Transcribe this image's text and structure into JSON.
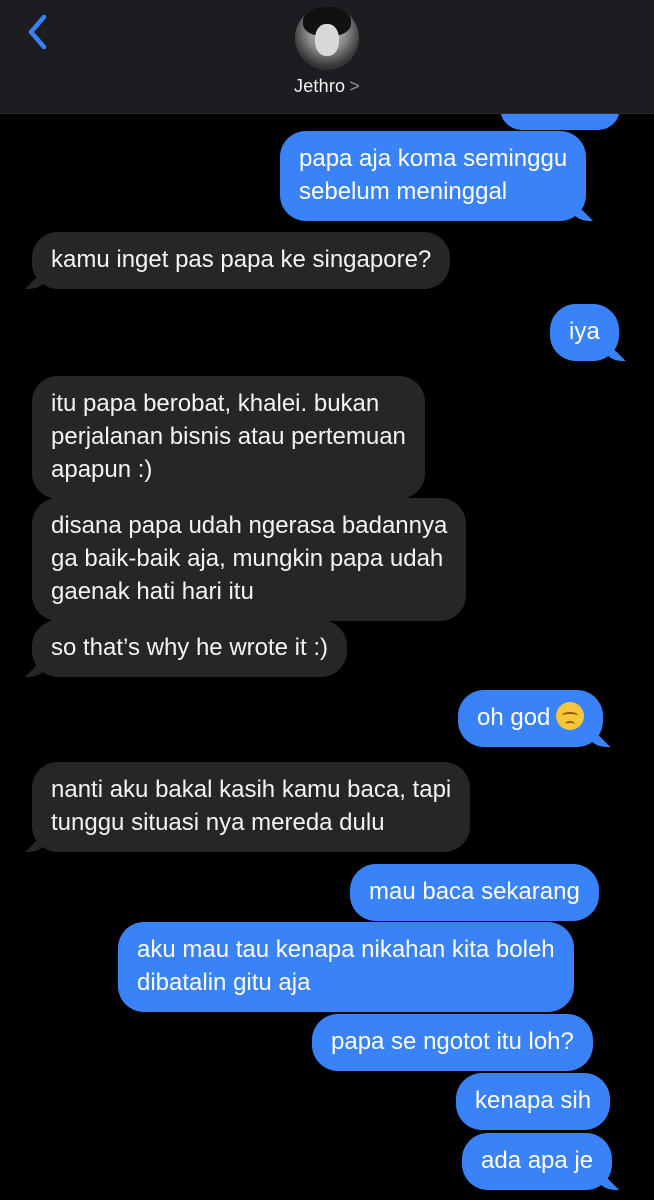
{
  "header": {
    "contact_name": "Jethro",
    "chevron": ">",
    "back_icon": "chevron-left-icon",
    "accent_color": "#3a82f7"
  },
  "messages": [
    {
      "from": "me",
      "text_lines": [
        "papa aja koma seminggu",
        "sebelum meninggal"
      ]
    },
    {
      "from": "them",
      "text_lines": [
        "kamu inget pas papa ke singapore?"
      ]
    },
    {
      "from": "me",
      "text_lines": [
        "iya"
      ]
    },
    {
      "from": "them",
      "text_lines": [
        "itu papa berobat, khalei. bukan",
        "perjalanan bisnis atau pertemuan",
        "apapun :)"
      ]
    },
    {
      "from": "them",
      "text_lines": [
        "disana papa udah ngerasa badannya",
        "ga baik-baik aja, mungkin papa udah",
        "gaenak hati hari itu"
      ]
    },
    {
      "from": "them",
      "text_lines": [
        "so that’s why he wrote it :)"
      ]
    },
    {
      "from": "me",
      "text_lines": [
        "oh god"
      ],
      "emoji": "pensive-face"
    },
    {
      "from": "them",
      "text_lines": [
        "nanti aku bakal kasih kamu baca, tapi",
        "tunggu situasi nya mereda dulu"
      ]
    },
    {
      "from": "me",
      "text_lines": [
        "mau baca sekarang"
      ]
    },
    {
      "from": "me",
      "text_lines": [
        "aku mau tau kenapa nikahan kita boleh",
        "dibatalin gitu aja"
      ]
    },
    {
      "from": "me",
      "text_lines": [
        "papa se ngotot itu loh?"
      ]
    },
    {
      "from": "me",
      "text_lines": [
        "kenapa sih"
      ]
    },
    {
      "from": "me",
      "text_lines": [
        "ada apa je"
      ]
    }
  ]
}
